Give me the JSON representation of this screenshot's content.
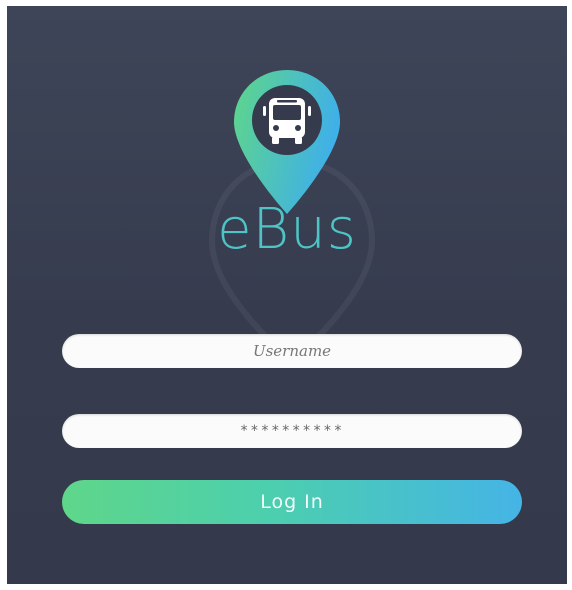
{
  "app": {
    "brand_name": "eBus"
  },
  "logo": {
    "icon": "bus-location-pin-icon",
    "gradient_start": "#5fd68a",
    "gradient_end": "#3fb0e8",
    "bus_color": "#353b4d"
  },
  "login": {
    "username_placeholder": "Username",
    "password_value": "**********",
    "login_label": "Log In"
  },
  "colors": {
    "background": "#3a4053",
    "brand_text": "#4fc4c6",
    "button_gradient_start": "#5fd68a",
    "button_gradient_end": "#45b4e6"
  }
}
